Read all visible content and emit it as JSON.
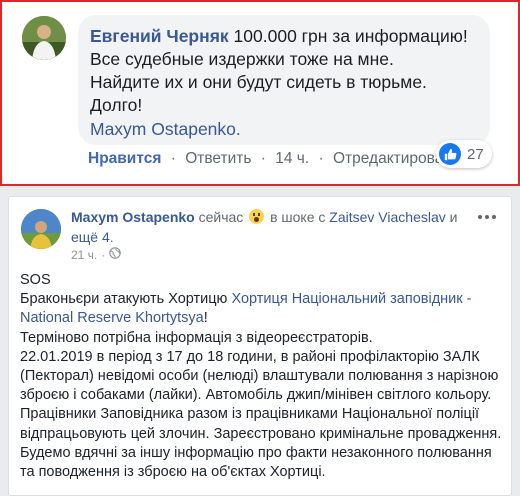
{
  "comment": {
    "author": "Евгений Черняк",
    "lines": [
      "100.000 грн за информацию!",
      "Все судебные издержки тоже на мне.",
      "Найдите их и они будут сидеть в тюрьме.",
      "Долго!"
    ],
    "mention": "Maxym Ostapenko.",
    "actions": {
      "like": "Нравится",
      "reply": "Ответить",
      "time": "14 ч.",
      "edited": "Отредактировано"
    },
    "reactions_count": "27",
    "colors": {
      "border": "#e0262b",
      "link": "#385898",
      "like_badge": "#1877f2"
    }
  },
  "post": {
    "author": "Maxym Ostapenko",
    "feeling_prefix": "сейчас",
    "feeling": "в шоке",
    "with_word": "с",
    "tagged": "Zaitsev Viacheslav",
    "and_word": "и",
    "others": "ещё 4",
    "time": "21 ч.",
    "body_start": "SOS\nБраконьєри атакують Хортицю",
    "page_link": "Хортиця Національний заповідник - National Reserve Khortytsya",
    "body_rest": "Терміново потрібна інформація з відеореєстраторів.\n22.01.2019 в період з 17 до 18 години, в районі профілакторію ЗАЛК (Пекторал) невідомі особи (нелюді) влаштували полювання з нарізною зброєю і собаками (лайки). Автомобіль джип/мінівен світлого кольору.\nПрацівники Заповідника разом із працівниками Національної поліції відпрацьовують цей злочин. Зареєстровано кримінальне провадження.\nБудемо вдячні за іншу інформацію про факти незаконного полювання та поводження із зброєю на об'єктах Хортиці."
  }
}
